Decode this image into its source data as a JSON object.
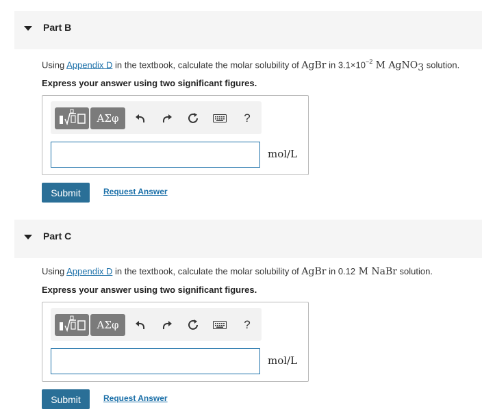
{
  "parts": [
    {
      "title": "Part B",
      "question": {
        "prefix": "Using ",
        "link": "Appendix D",
        "middle": " in the textbook, calculate the molar solubility of ",
        "compound": "AgBr",
        "in_text": " in ",
        "conc_base": "3.1×10",
        "conc_exp": "−2",
        "solvent": " M AgNO",
        "solvent_sub": "3",
        "suffix": " solution."
      },
      "instruction": "Express your answer using two significant figures.",
      "greek_label": "ΑΣφ",
      "help_label": "?",
      "answer_value": "",
      "units": "mol/L",
      "submit_label": "Submit",
      "request_label": "Request Answer"
    },
    {
      "title": "Part C",
      "question": {
        "prefix": "Using ",
        "link": "Appendix D",
        "middle": " in the textbook, calculate the molar solubility of ",
        "compound": "AgBr",
        "in_text": " in ",
        "conc": "0.12",
        "solvent": " M NaBr",
        "suffix": " solution."
      },
      "instruction": "Express your answer using two significant figures.",
      "greek_label": "ΑΣφ",
      "help_label": "?",
      "answer_value": "",
      "units": "mol/L",
      "submit_label": "Submit",
      "request_label": "Request Answer"
    }
  ]
}
